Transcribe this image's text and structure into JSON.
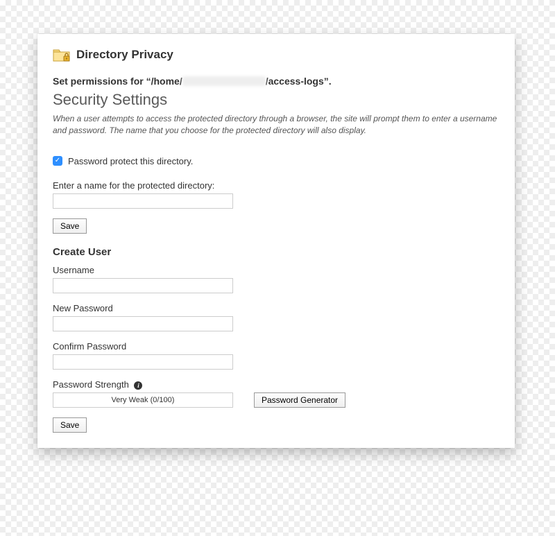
{
  "header": {
    "title": "Directory Privacy"
  },
  "permissions": {
    "prefix": "Set permissions for “/home/",
    "suffix": "/access-logs”."
  },
  "security": {
    "heading": "Security Settings",
    "hint": "When a user attempts to access the protected directory through a browser, the site will prompt them to enter a username and password. The name that you choose for the protected directory will also display.",
    "checkbox_label": "Password protect this directory.",
    "checkbox_checked": true,
    "name_label": "Enter a name for the protected directory:",
    "name_value": "",
    "save_label": "Save"
  },
  "create_user": {
    "heading": "Create User",
    "username_label": "Username",
    "username_value": "",
    "new_password_label": "New Password",
    "new_password_value": "",
    "confirm_password_label": "Confirm Password",
    "confirm_password_value": "",
    "strength_label": "Password Strength",
    "strength_text": "Very Weak (0/100)",
    "generator_label": "Password Generator",
    "save_label": "Save"
  }
}
